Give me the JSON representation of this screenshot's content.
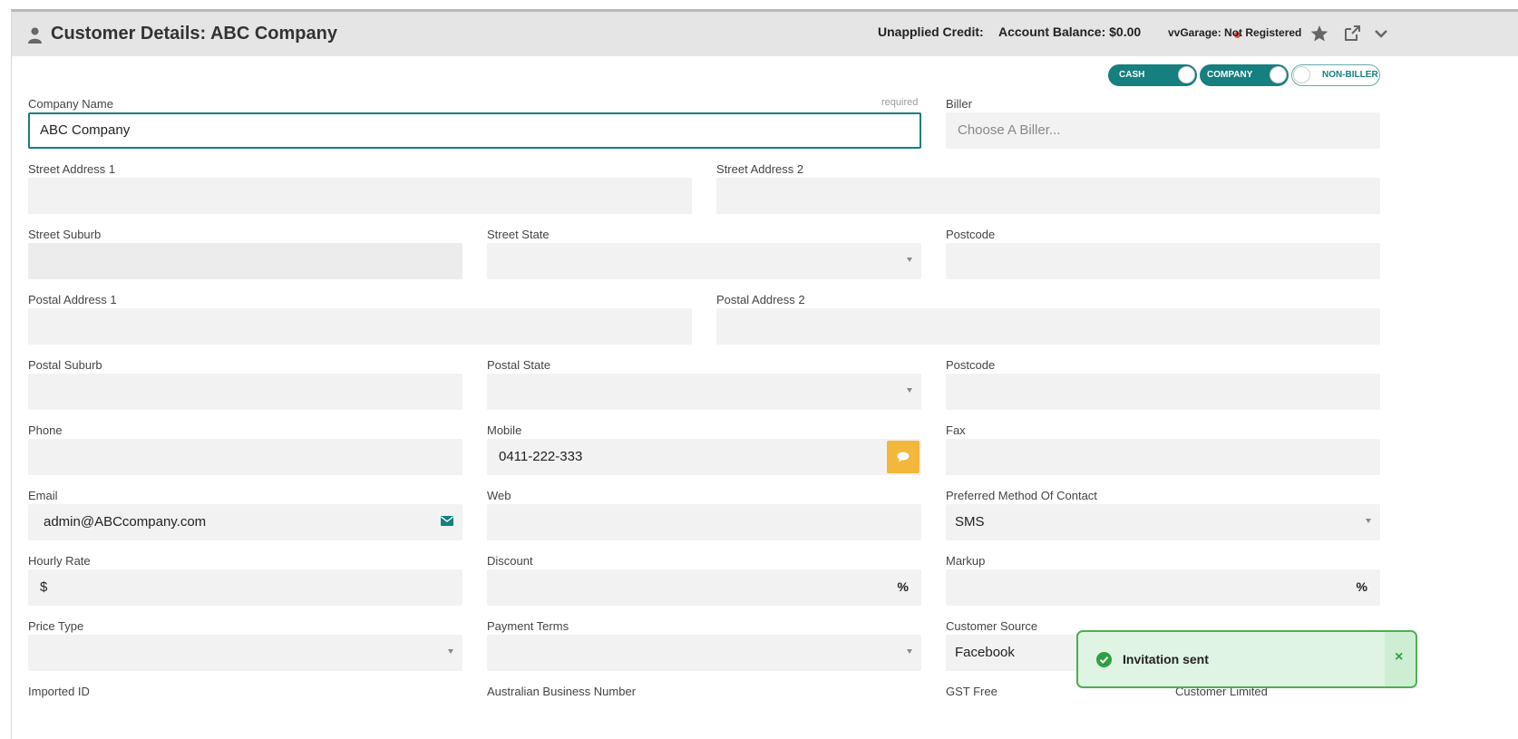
{
  "header": {
    "title": "Customer Details:  ABC Company",
    "unapplied_credit": "Unapplied Credit:",
    "account_balance": "Account Balance: $0.00",
    "vvgarage": "vvGarage: Not Registered",
    "icons": [
      "user-icon",
      "star-icon",
      "external-link-icon",
      "chevron-down-icon"
    ]
  },
  "toggles": [
    {
      "label": "CASH",
      "state": "on"
    },
    {
      "label": "COMPANY",
      "state": "on"
    },
    {
      "label": "NON-BILLER",
      "state": "off"
    }
  ],
  "form": {
    "company_name": {
      "label": "Company Name",
      "required": "required",
      "value": "ABC Company"
    },
    "biller": {
      "label": "Biller",
      "placeholder": "Choose A Biller..."
    },
    "street_address_1": {
      "label": "Street Address 1",
      "value": ""
    },
    "street_address_2": {
      "label": "Street Address 2",
      "value": ""
    },
    "street_suburb": {
      "label": "Street Suburb",
      "value": ""
    },
    "street_state": {
      "label": "Street State",
      "value": ""
    },
    "street_postcode": {
      "label": "Postcode",
      "value": ""
    },
    "postal_address_1": {
      "label": "Postal Address 1",
      "value": ""
    },
    "postal_address_2": {
      "label": "Postal Address 2",
      "value": ""
    },
    "postal_suburb": {
      "label": "Postal Suburb",
      "value": ""
    },
    "postal_state": {
      "label": "Postal State",
      "value": ""
    },
    "postal_postcode": {
      "label": "Postcode",
      "value": ""
    },
    "phone": {
      "label": "Phone",
      "value": ""
    },
    "mobile": {
      "label": "Mobile",
      "value": "0411-222-333"
    },
    "fax": {
      "label": "Fax",
      "value": ""
    },
    "email": {
      "label": "Email",
      "value": "admin@ABCcompany.com"
    },
    "web": {
      "label": "Web",
      "value": ""
    },
    "preferred_contact": {
      "label": "Preferred Method Of Contact",
      "value": "SMS"
    },
    "hourly_rate": {
      "label": "Hourly Rate",
      "prefix": "$"
    },
    "discount": {
      "label": "Discount",
      "suffix": "%"
    },
    "markup": {
      "label": "Markup",
      "suffix": "%"
    },
    "price_type": {
      "label": "Price Type",
      "value": ""
    },
    "payment_terms": {
      "label": "Payment Terms",
      "value": ""
    },
    "customer_source": {
      "label": "Customer Source",
      "value": "Facebook"
    },
    "imported_id": {
      "label": "Imported ID"
    },
    "abn": {
      "label": "Australian Business Number"
    },
    "gst_free": {
      "label": "GST Free"
    },
    "customer_limited": {
      "label": "Customer Limited"
    }
  },
  "toast": {
    "message": "Invitation sent",
    "close": "×"
  },
  "colors": {
    "accent": "#167f7f",
    "sms": "#f3b73b",
    "success": "#2ea043"
  }
}
